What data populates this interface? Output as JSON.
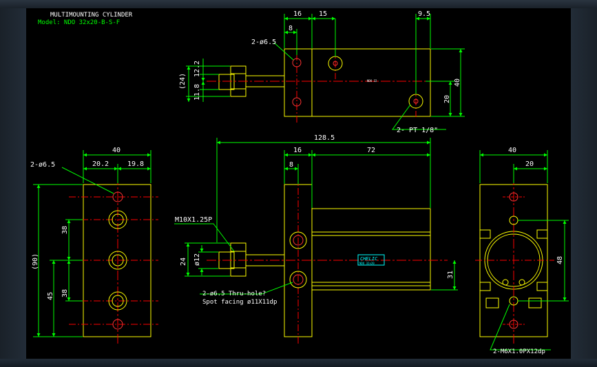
{
  "title": {
    "line1": "MULTIMOUNTING CYLINDER",
    "line2": "Model: NDO 32x20-B-S-F"
  },
  "colors": {
    "background": "#000000",
    "outline": "#ffff00",
    "dimension": "#00ff00",
    "hole": "#ff3333",
    "centerline": "#ff0000",
    "text": "#ffffff",
    "label": "#00ffff"
  },
  "top_view": {
    "dims": {
      "d16": "16",
      "d15": "15",
      "d9_5": "9.5",
      "d8": "8",
      "d24": "(24)",
      "d12_2": "12.2",
      "d11_8": "11.8",
      "d40": "40",
      "d20": "20"
    },
    "callouts": {
      "holes": "2-ø6.5",
      "port": "2- PT 1/8\""
    },
    "nameplate": "NDO 32"
  },
  "front_view": {
    "dims": {
      "d128_5": "128.5",
      "d16": "16",
      "d72": "72",
      "d8": "8",
      "d24": "24",
      "phi12": "ø12",
      "d31": "31"
    },
    "callouts": {
      "thread": "M10X1.25P",
      "holes_line1": "2-ø6.5 Thru-hole?",
      "holes_line2": "Spot facing  ø11X11dp"
    },
    "brand": "CHELIC",
    "brand_sub": "NDO 32x20"
  },
  "left_view": {
    "dims": {
      "d40": "40",
      "d20_2": "20.2",
      "d19_8": "19.8",
      "d90": "(90)",
      "d38a": "38",
      "d38b": "38",
      "d45": "45"
    },
    "callouts": {
      "holes": "2-ø6.5"
    }
  },
  "right_view": {
    "dims": {
      "d40": "40",
      "d20": "20",
      "d48": "48"
    },
    "callouts": {
      "thread": "2-M6X1.0PX12dp"
    }
  }
}
